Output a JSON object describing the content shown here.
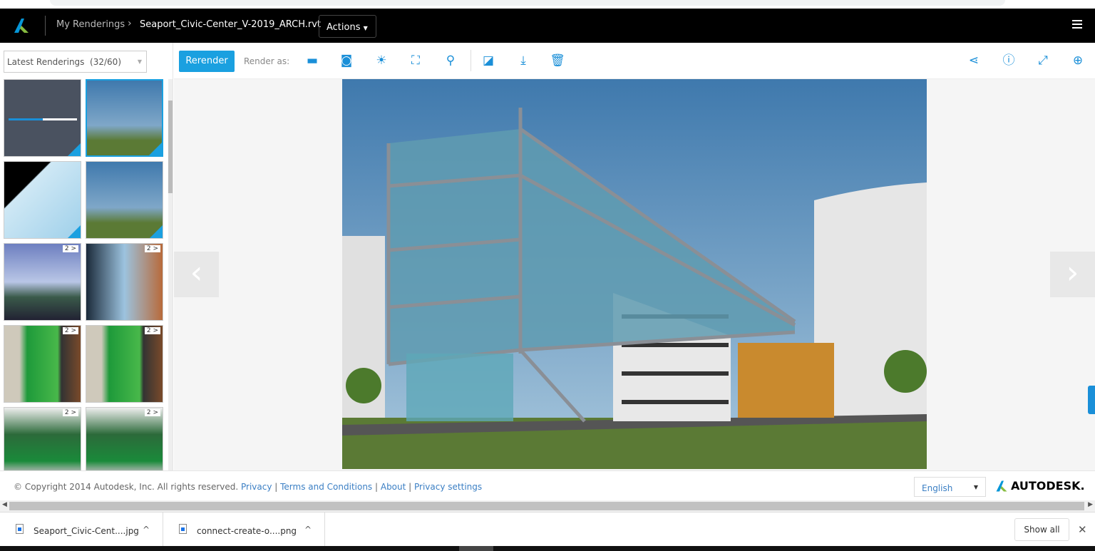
{
  "header": {
    "breadcrumb": [
      "My Renderings",
      "Seaport_Civic-Center_V-2019_ARCH.rvt"
    ],
    "actions_label": "Actions",
    "brand_color": "#1aa0e0"
  },
  "sidebar": {
    "filter_value": "Latest Renderings  (32/60)",
    "thumbnails": [
      {
        "kind": "progress",
        "badge": "",
        "premium": true,
        "progress": 0.5
      },
      {
        "kind": "exterior",
        "badge": "",
        "premium": true,
        "selected": true
      },
      {
        "kind": "exterior-night",
        "badge": "",
        "premium": true
      },
      {
        "kind": "exterior",
        "badge": "",
        "premium": true
      },
      {
        "kind": "interior-lobby",
        "badge": "2 >"
      },
      {
        "kind": "interior-corridor",
        "badge": "2 >"
      },
      {
        "kind": "interior-green",
        "badge": "2 >"
      },
      {
        "kind": "interior-green",
        "badge": "2 >"
      },
      {
        "kind": "interior-gallery",
        "badge": "2 >"
      },
      {
        "kind": "interior-gallery",
        "badge": "2 >"
      }
    ]
  },
  "toolbar": {
    "rerender_label": "Rerender",
    "render_as_label": "Render as:",
    "render_icons": [
      "panorama-icon",
      "vr-headset-icon",
      "sun-icon",
      "illuminance-icon",
      "solar-study-icon"
    ],
    "action_icons": [
      "edit-exposure-icon",
      "download-icon",
      "trash-icon"
    ],
    "right_icons": [
      "share-icon",
      "info-icon",
      "fullscreen-icon",
      "zoom-in-icon"
    ]
  },
  "footer": {
    "copyright": "© Copyright 2014 Autodesk, Inc. All rights reserved.",
    "links": [
      "Privacy",
      "Terms and Conditions",
      "About",
      "Privacy settings"
    ],
    "language": "English",
    "brand": "AUTODESK."
  },
  "downloads": {
    "items": [
      "Seaport_Civic-Cent....jpg",
      "connect-create-o....png"
    ],
    "show_all": "Show all"
  }
}
